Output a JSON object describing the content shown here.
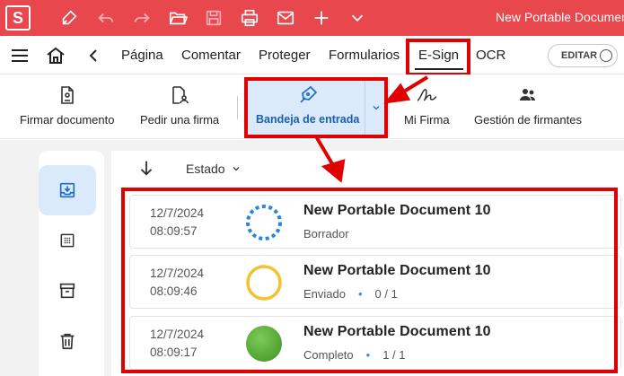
{
  "titlebar": {
    "logo": "S",
    "window_title": "New Portable Documen",
    "icons": [
      "pen-icon",
      "undo-icon",
      "redo-icon",
      "open-folder-icon",
      "save-icon",
      "print-icon",
      "email-icon",
      "add-icon",
      "chevron-down-icon"
    ]
  },
  "menubar": {
    "tabs": [
      "Página",
      "Comentar",
      "Proteger",
      "Formularios",
      "E-Sign",
      "OCR"
    ],
    "active_tab": "E-Sign",
    "edit_toggle": "EDITAR"
  },
  "ribbon": {
    "items": [
      {
        "label": "Firmar documento",
        "icon": "sign-document-icon"
      },
      {
        "label": "Pedir una firma",
        "icon": "request-signature-icon"
      },
      {
        "label": "Bandeja de entrada",
        "icon": "pen-nib-icon"
      },
      {
        "label": "Mi Firma",
        "icon": "signature-icon"
      },
      {
        "label": "Gestión de firmantes",
        "icon": "people-icon"
      }
    ]
  },
  "sidebar": {
    "items": [
      "inbox-icon",
      "grid-icon",
      "archive-icon",
      "trash-icon"
    ]
  },
  "filter": {
    "estado_label": "Estado"
  },
  "documents": [
    {
      "date": "12/7/2024",
      "time": "08:09:57",
      "name": "New Portable Document 10",
      "status": "Borrador",
      "progress": "",
      "status_kind": "draft"
    },
    {
      "date": "12/7/2024",
      "time": "08:09:46",
      "name": "New Portable Document 10",
      "status": "Enviado",
      "progress": "0 / 1",
      "status_kind": "sent"
    },
    {
      "date": "12/7/2024",
      "time": "08:09:17",
      "name": "New Portable Document 10",
      "status": "Completo",
      "progress": "1 / 1",
      "status_kind": "complete"
    }
  ],
  "colors": {
    "brand": "#e8474e",
    "highlight": "#e00000",
    "active_bg": "#dbeafb",
    "draft": "#2a86d6",
    "sent": "#f2c230",
    "complete": "#5ab03b"
  }
}
